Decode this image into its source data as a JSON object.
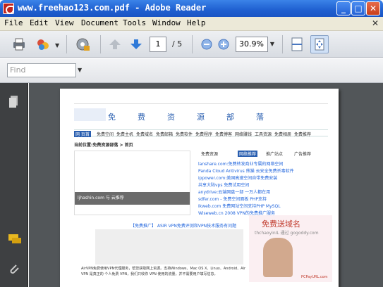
{
  "window": {
    "title": "www.freehao123.com.pdf - Adobe Reader",
    "min": "_",
    "max": "□",
    "close": "✕"
  },
  "menu": [
    "File",
    "Edit",
    "View",
    "Document",
    "Tools",
    "Window",
    "Help"
  ],
  "menu_close": "✕",
  "toolbar": {
    "page_current": "1",
    "page_total": "/ 5",
    "zoom": "30.9%"
  },
  "find": {
    "placeholder": "Find"
  },
  "pdf": {
    "site_name": [
      "免",
      "费",
      "资",
      "源",
      "部",
      "落"
    ],
    "nav_items": [
      "网 页首",
      "免费空间",
      "免费主机",
      "免费域名",
      "免费邮箱",
      "免费软件",
      "免费程序",
      "免费博客",
      "网络赚钱",
      "工具资源",
      "免费相册",
      "免费推荐"
    ],
    "breadcrumb": "当前位置:免费资源部落 > 首页",
    "tabs": [
      "免费资源",
      "网络推荐",
      "推广站点",
      "广告推荐"
    ],
    "list": [
      "lanshare.com:免费转发商业专属的网络空间",
      "Panda Cloud Antivirus 熊猫 云安全免费杀毒软件",
      "ippower.com:美国高速空间自带免费安装",
      "共享大陆vps 免费试用空间",
      "anydrive:云端网盘一部 一万人都在用",
      "sdfer.com - 免费空间面板 PHP支持",
      "Ikweb.com 免费网站空间支持PHP MySQL",
      "Wiseweb.cn 2008 VPN的免费推广服务"
    ],
    "img_caption": "ljhashin.com 与 云推荐",
    "footer_link": "【免费推广】 ASIR VPN免费评测和VPN技术服务有问题",
    "ad_title": "免费送域名",
    "ad_sub": "thchaoyinIL 通过 gogoddy.com",
    "ad_brand": "PCPayURL.com",
    "body_text": "AirVPN免费使用VPN代理服务，帮您获取网上资源。支持Windows、Mac OS X、Linux、Android、Air VPN 是真正的 个人免费 VPN，我们只收你 VPN 使用的流量，并不需要用户填写信息。"
  }
}
